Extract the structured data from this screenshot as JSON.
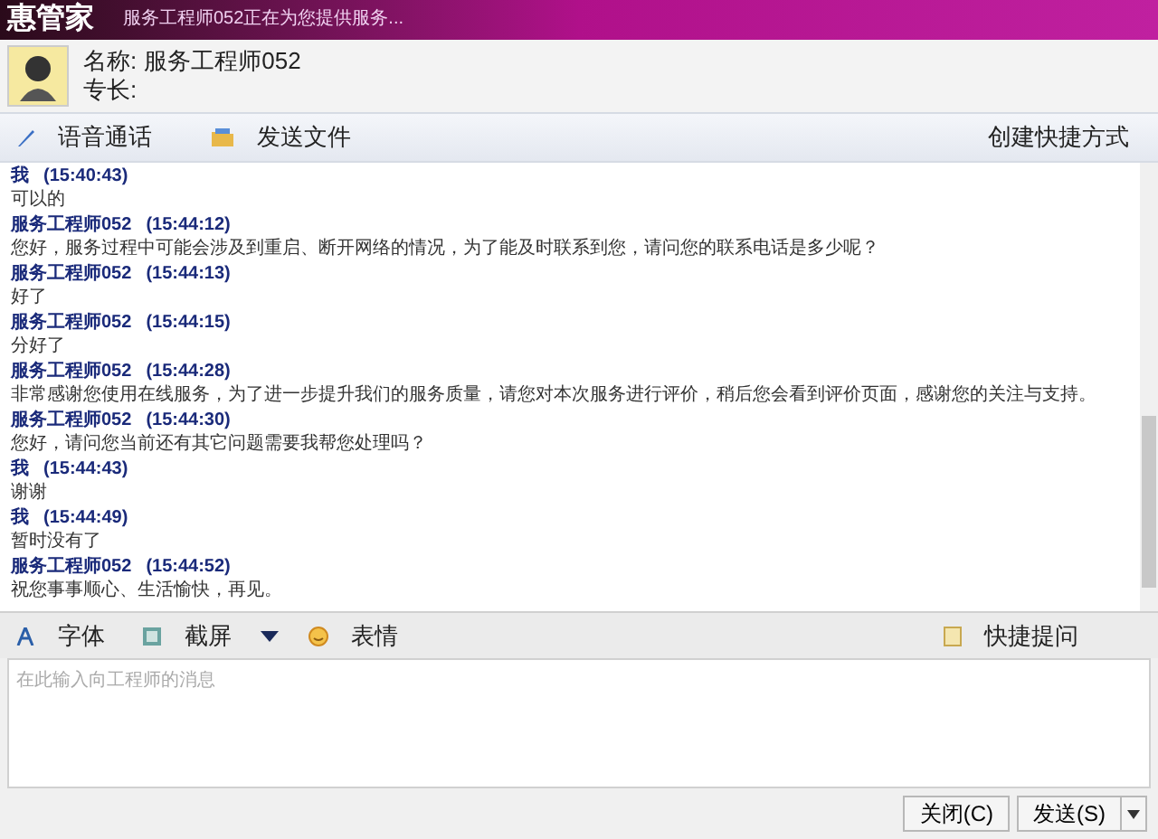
{
  "window": {
    "logo": "惠管家",
    "title": "服务工程师052正在为您提供服务..."
  },
  "contact": {
    "name_label": "名称:",
    "name": "服务工程师052",
    "specialty_label": "专长:"
  },
  "top_toolbar": {
    "items": [
      {
        "kind": "mic",
        "label": "语音通话"
      },
      {
        "kind": "folder",
        "label": "发送文件"
      }
    ],
    "right": "创建快捷方式"
  },
  "messages": [
    {
      "sender": "我",
      "time": "(15:40:43)",
      "text": "可以的"
    },
    {
      "sender": "服务工程师052",
      "time": "(15:44:12)",
      "text": "您好，服务过程中可能会涉及到重启、断开网络的情况，为了能及时联系到您，请问您的联系电话是多少呢？"
    },
    {
      "sender": "服务工程师052",
      "time": "(15:44:13)",
      "text": "好了"
    },
    {
      "sender": "服务工程师052",
      "time": "(15:44:15)",
      "text": "分好了"
    },
    {
      "sender": "服务工程师052",
      "time": "(15:44:28)",
      "text": "非常感谢您使用在线服务，为了进一步提升我们的服务质量，请您对本次服务进行评价，稍后您会看到评价页面，感谢您的关注与支持。"
    },
    {
      "sender": "服务工程师052",
      "time": "(15:44:30)",
      "text": "您好，请问您当前还有其它问题需要我帮您处理吗？"
    },
    {
      "sender": "我",
      "time": "(15:44:43)",
      "text": "谢谢"
    },
    {
      "sender": "我",
      "time": "(15:44:49)",
      "text": "暂时没有了"
    },
    {
      "sender": "服务工程师052",
      "time": "(15:44:52)",
      "text": "祝您事事顺心、生活愉快，再见。"
    }
  ],
  "bottom_toolbar": {
    "items": [
      {
        "kind": "font",
        "label": "字体"
      },
      {
        "kind": "screenshot",
        "label": "截屏"
      },
      {
        "kind": "emoji",
        "label": "表情"
      }
    ],
    "right": "快捷提问"
  },
  "input": {
    "placeholder": "在此输入向工程师的消息"
  },
  "buttons": {
    "close": "关闭(C)",
    "send": "发送(S)"
  }
}
